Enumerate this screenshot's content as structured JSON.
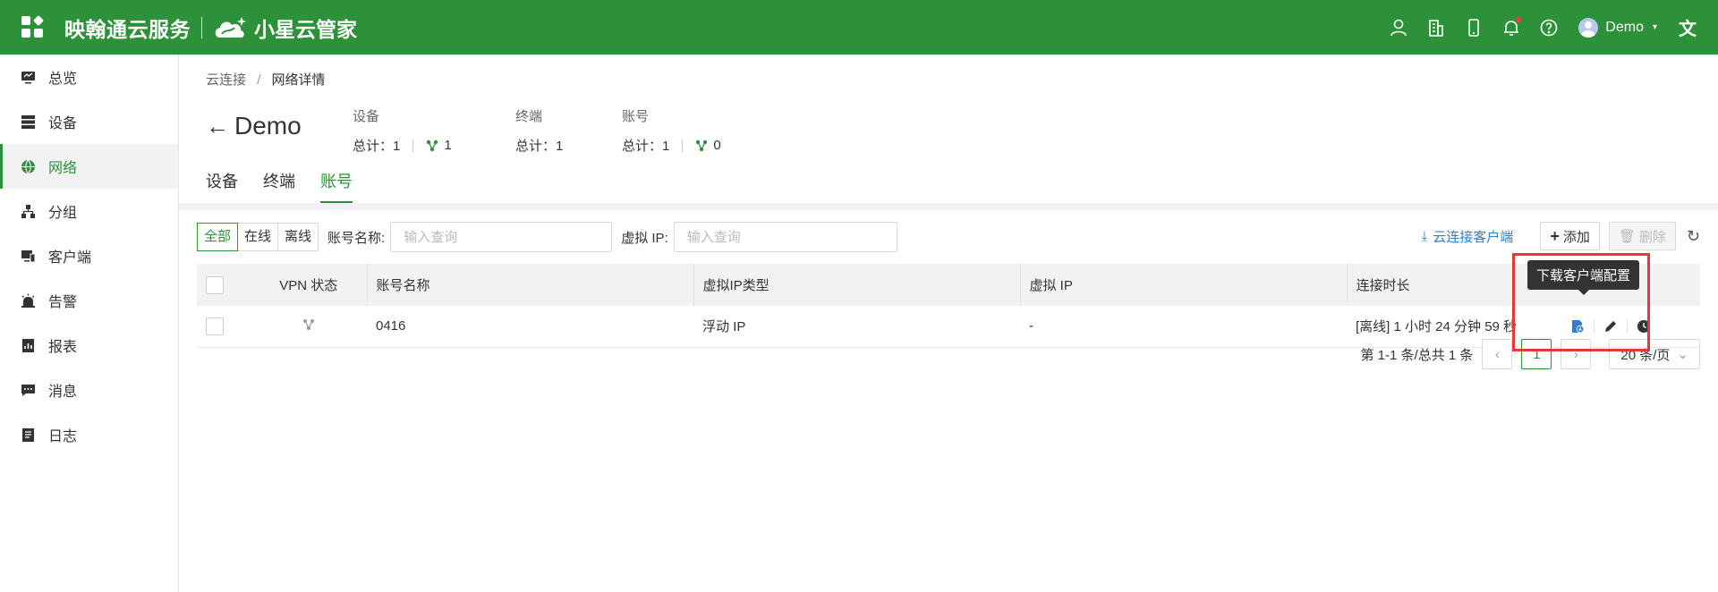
{
  "header": {
    "brand": "映翰通云服务",
    "product": "小星云管家",
    "user_name": "Demo"
  },
  "sidebar": {
    "items": [
      {
        "label": "总览",
        "icon": "monitor-icon"
      },
      {
        "label": "设备",
        "icon": "server-icon"
      },
      {
        "label": "网络",
        "icon": "globe-icon"
      },
      {
        "label": "分组",
        "icon": "hierarchy-icon"
      },
      {
        "label": "客户端",
        "icon": "client-icon"
      },
      {
        "label": "告警",
        "icon": "alarm-icon"
      },
      {
        "label": "报表",
        "icon": "report-icon"
      },
      {
        "label": "消息",
        "icon": "message-icon"
      },
      {
        "label": "日志",
        "icon": "log-icon"
      }
    ],
    "active_index": 2
  },
  "breadcrumb": {
    "parent": "云连接",
    "separator": "/",
    "current": "网络详情"
  },
  "page_title": "Demo",
  "stats": {
    "device": {
      "label": "设备",
      "total_text": "总计：1",
      "online": "1"
    },
    "terminal": {
      "label": "终端",
      "total_text": "总计：1"
    },
    "account": {
      "label": "账号",
      "total_text": "总计：1",
      "online": "0"
    }
  },
  "tabs": [
    "设备",
    "终端",
    "账号"
  ],
  "active_tab": 2,
  "filters": {
    "segments": [
      "全部",
      "在线",
      "离线"
    ],
    "account_label": "账号名称:",
    "account_placeholder": "输入查询",
    "vip_label": "虚拟 IP:",
    "vip_placeholder": "输入查询"
  },
  "actions": {
    "download_client": "云连接客户端",
    "add": "添加",
    "delete": "删除"
  },
  "table": {
    "headers": [
      "VPN 状态",
      "账号名称",
      "虚拟IP类型",
      "虚拟 IP",
      "连接时长"
    ],
    "rows": [
      {
        "name": "0416",
        "ip_type": "浮动 IP",
        "vip": "-",
        "duration": "[离线] 1 小时 24 分钟 59 秒"
      }
    ]
  },
  "tooltip": "下载客户端配置",
  "pagination": {
    "summary": "第 1-1 条/总共 1 条",
    "current_page": "1",
    "page_size": "20 条/页"
  },
  "colors": {
    "brand": "#2d9139",
    "link": "#2b7fd5",
    "highlight": "#e53935"
  }
}
